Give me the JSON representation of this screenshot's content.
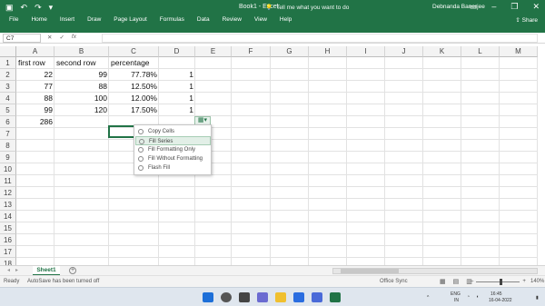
{
  "window": {
    "title": "Book1 - Excel",
    "tellme": "Tell me what you want to do",
    "user": "Debnanda Banerjee",
    "share": "Share"
  },
  "ribbon": {
    "tabs": [
      "File",
      "Home",
      "Insert",
      "Draw",
      "Page Layout",
      "Formulas",
      "Data",
      "Review",
      "View",
      "Help"
    ]
  },
  "formula_bar": {
    "name_box": "C7",
    "value": ""
  },
  "columns": [
    "A",
    "B",
    "C",
    "D",
    "E",
    "F",
    "G",
    "H",
    "I",
    "J",
    "K",
    "L",
    "M"
  ],
  "rows": [
    "1",
    "2",
    "3",
    "4",
    "5",
    "6",
    "7",
    "8",
    "9",
    "10",
    "11",
    "12",
    "13",
    "14",
    "15",
    "16",
    "17",
    "18"
  ],
  "cells": {
    "a1": "first row",
    "b1": "second row",
    "c1": "percentage",
    "a2": "22",
    "b2": "99",
    "c2": "77.78%",
    "d2": "1",
    "a3": "77",
    "b3": "88",
    "c3": "12.50%",
    "d3": "1",
    "a4": "88",
    "b4": "100",
    "c4": "12.00%",
    "d4": "1",
    "a5": "99",
    "b5": "120",
    "c5": "17.50%",
    "d5": "1",
    "a6": "286"
  },
  "paste_menu": {
    "items": [
      "Copy Cells",
      "Fill Series",
      "Fill Formatting Only",
      "Fill Without Formatting",
      "Flash Fill"
    ],
    "highlighted_index": 1
  },
  "sheet_tabs": [
    "Sheet1"
  ],
  "status": {
    "ready": "Ready",
    "autosave": "AutoSave has been turned off",
    "sync": "Office Sync",
    "zoom": "140%"
  },
  "taskbar": {
    "lang": "ENG",
    "region": "IN",
    "time": "16:45",
    "date": "16-04-2022"
  },
  "colors": {
    "accent": "#217346"
  }
}
